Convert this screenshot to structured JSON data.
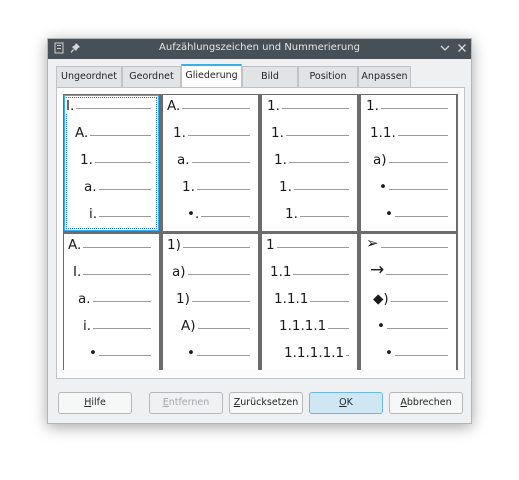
{
  "window": {
    "title": "Aufzählungszeichen und Nummerierung"
  },
  "titlebar_icons": {
    "app": "app-icon",
    "pin": "pin-icon",
    "minimize": "chevron-down-icon",
    "close": "close-icon"
  },
  "tabs": [
    {
      "id": "ungeordnet",
      "label": "Ungeordnet",
      "active": false
    },
    {
      "id": "geordnet",
      "label": "Geordnet",
      "active": false
    },
    {
      "id": "gliederung",
      "label": "Gliederung",
      "active": true
    },
    {
      "id": "bild",
      "label": "Bild",
      "active": false
    },
    {
      "id": "position",
      "label": "Position",
      "active": false
    },
    {
      "id": "anpassen",
      "label": "Anpassen",
      "active": false
    }
  ],
  "outline_presets": [
    {
      "selected": true,
      "levels": [
        "I.",
        "A.",
        "1.",
        "a.",
        "i."
      ]
    },
    {
      "selected": false,
      "levels": [
        "A.",
        "1.",
        "a.",
        "1.",
        "•."
      ]
    },
    {
      "selected": false,
      "levels": [
        "1.",
        "1.",
        "1.",
        "1.",
        "1."
      ]
    },
    {
      "selected": false,
      "levels": [
        "1.",
        "1.1.",
        "a)",
        "•",
        "•"
      ]
    },
    {
      "selected": false,
      "levels": [
        "A.",
        "I.",
        "a.",
        "i.",
        "•"
      ]
    },
    {
      "selected": false,
      "levels": [
        "1)",
        "a)",
        "1)",
        "A)",
        "•"
      ]
    },
    {
      "selected": false,
      "levels": [
        "1",
        "1.1",
        "1.1.1",
        "1.1.1.1",
        "1.1.1.1.1"
      ]
    },
    {
      "selected": false,
      "levels": [
        "➢",
        "→",
        "◆)",
        "•",
        "•"
      ]
    }
  ],
  "buttons": {
    "help": {
      "pre": "",
      "mn": "H",
      "post": "ilfe"
    },
    "remove": {
      "pre": "",
      "mn": "E",
      "post": "ntfernen",
      "disabled": true
    },
    "reset": {
      "pre": "",
      "mn": "Z",
      "post": "urücksetzen"
    },
    "ok": {
      "pre": "",
      "mn": "O",
      "post": "K"
    },
    "cancel": {
      "pre": "",
      "mn": "A",
      "post": "bbrechen"
    }
  },
  "colors": {
    "accent": "#3daee9",
    "titlebar": "#475057"
  }
}
